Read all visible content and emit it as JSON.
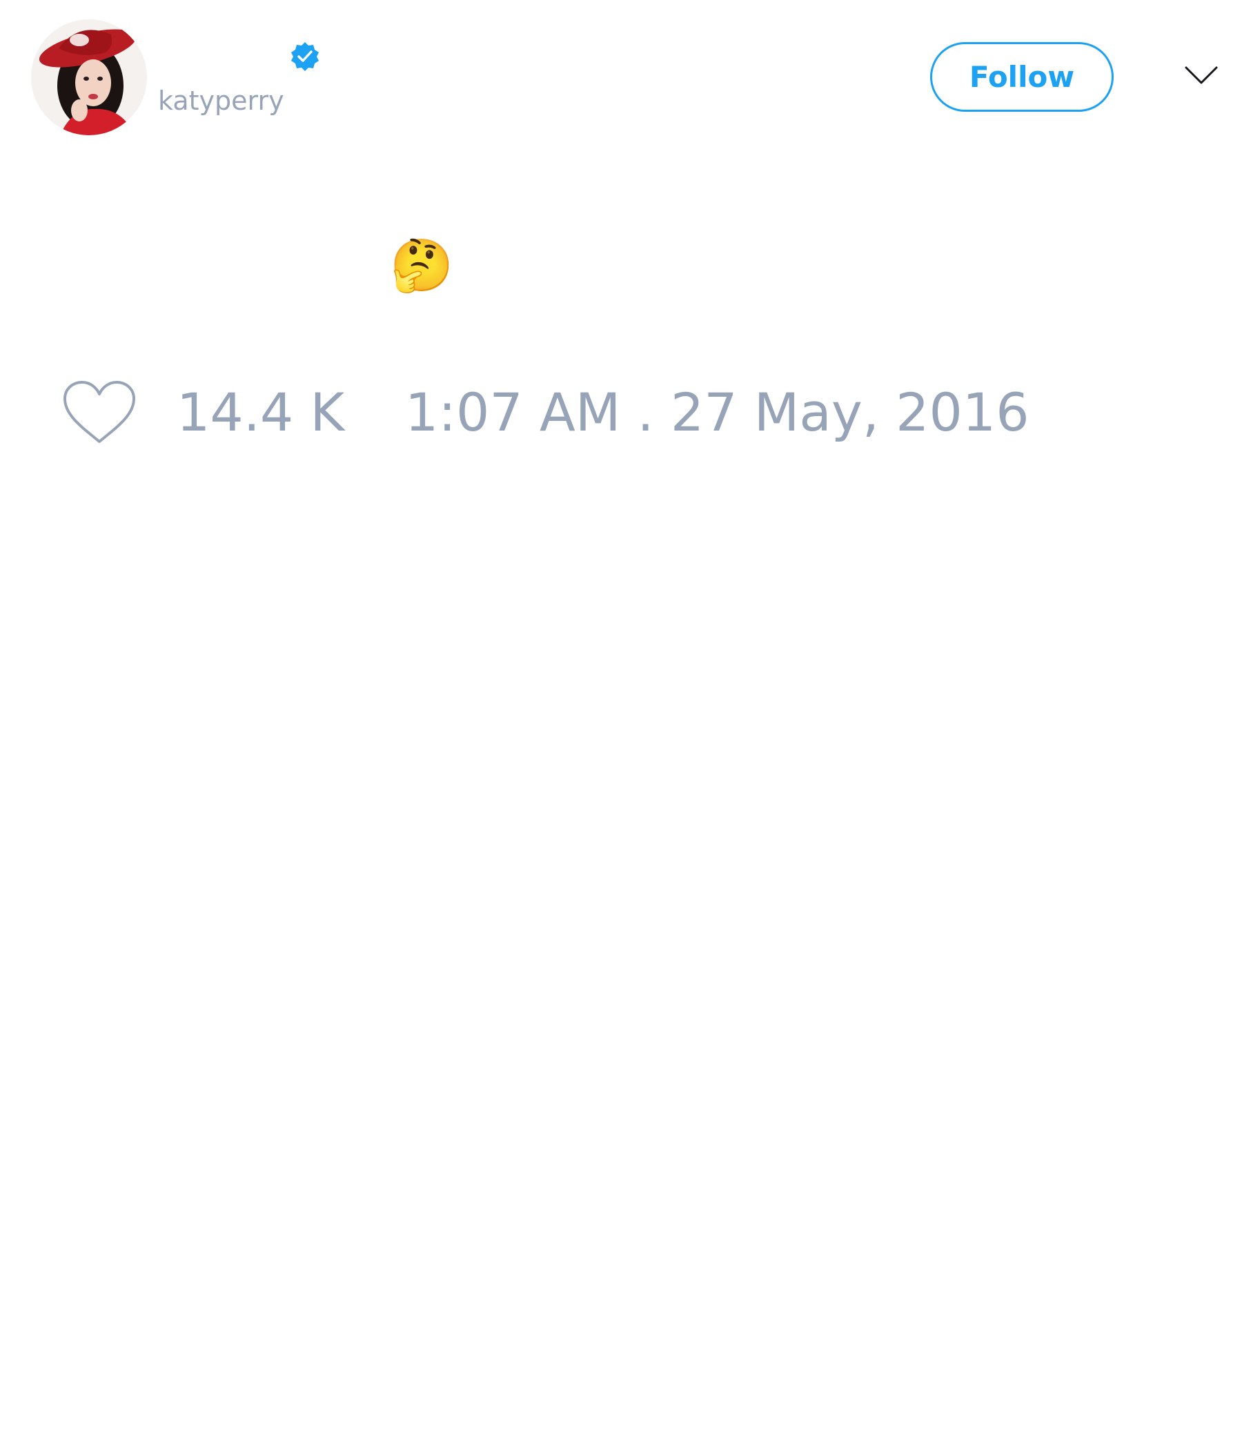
{
  "user": {
    "handle": "katyperry",
    "verified": true,
    "avatar": "profile-photo"
  },
  "header": {
    "follow_label": "Follow",
    "menu_icon": "chevron-down-icon"
  },
  "tweet": {
    "text": "🤔"
  },
  "footer": {
    "like_icon": "heart-icon",
    "like_count": "14.4 K",
    "timestamp": "1:07 AM . 27 May, 2016"
  },
  "colors": {
    "accent": "#1da1f2",
    "muted": "#97a4b8"
  }
}
